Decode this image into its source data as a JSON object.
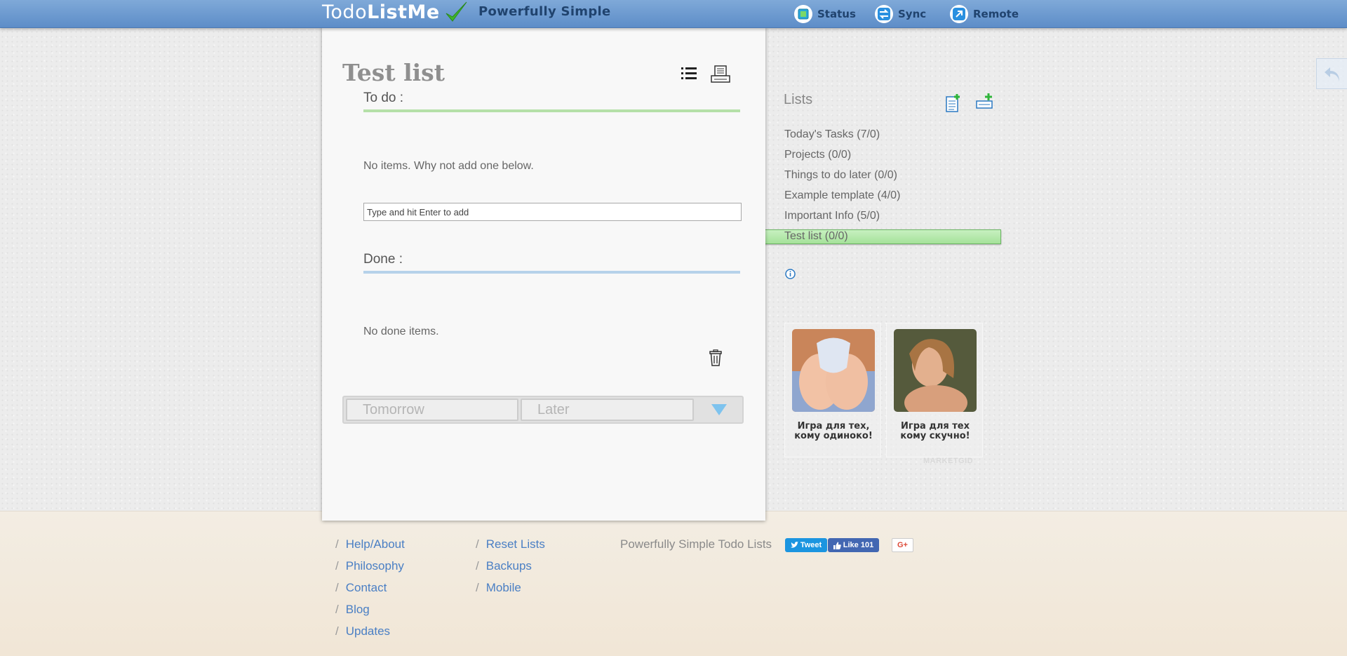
{
  "header": {
    "logo_part1": "Todo",
    "logo_part2": "ListMe",
    "tagline": "Powerfully Simple",
    "nav": [
      {
        "label": "Status",
        "icon": "status-icon"
      },
      {
        "label": "Sync",
        "icon": "sync-icon"
      },
      {
        "label": "Remote",
        "icon": "remote-icon"
      }
    ],
    "colors": {
      "bar": "#6b99d0",
      "tagline": "#20436e",
      "check": "#3fb52b"
    }
  },
  "list": {
    "title": "Test list",
    "todo_heading": "To do :",
    "todo_empty": "No items. Why not add one below.",
    "add_placeholder": "Type and hit Enter to add",
    "done_heading": "Done :",
    "done_empty": "No done items.",
    "tabs": [
      "Tomorrow",
      "Later"
    ],
    "colors": {
      "todo_rule": "#b5e0a8",
      "done_rule": "#b6d2ea"
    }
  },
  "sidebar": {
    "title": "Lists",
    "items": [
      {
        "label": "Today's Tasks (7/0)"
      },
      {
        "label": "Projects (0/0)"
      },
      {
        "label": "Things to do later (0/0)"
      },
      {
        "label": "Example template (4/0)"
      },
      {
        "label": "Important Info (5/0)"
      },
      {
        "label": "Test list (0/0)",
        "active": true
      }
    ],
    "active_color": "#b5e8ab"
  },
  "ads": {
    "items": [
      {
        "text": "Игра для тех, кому одиноко!"
      },
      {
        "text": "Игра для тех кому скучно!"
      }
    ],
    "brand": "MARKETGID"
  },
  "footer": {
    "col1": [
      "Help/About",
      "Philosophy",
      "Contact",
      "Blog",
      "Updates"
    ],
    "col2": [
      "Reset Lists",
      "Backups",
      "Mobile"
    ],
    "tagline": "Powerfully Simple Todo Lists",
    "separator": "/",
    "social": {
      "tweet": "Tweet",
      "like": "Like 101",
      "gplus": "G+"
    },
    "link_color": "#4a7fc4"
  }
}
